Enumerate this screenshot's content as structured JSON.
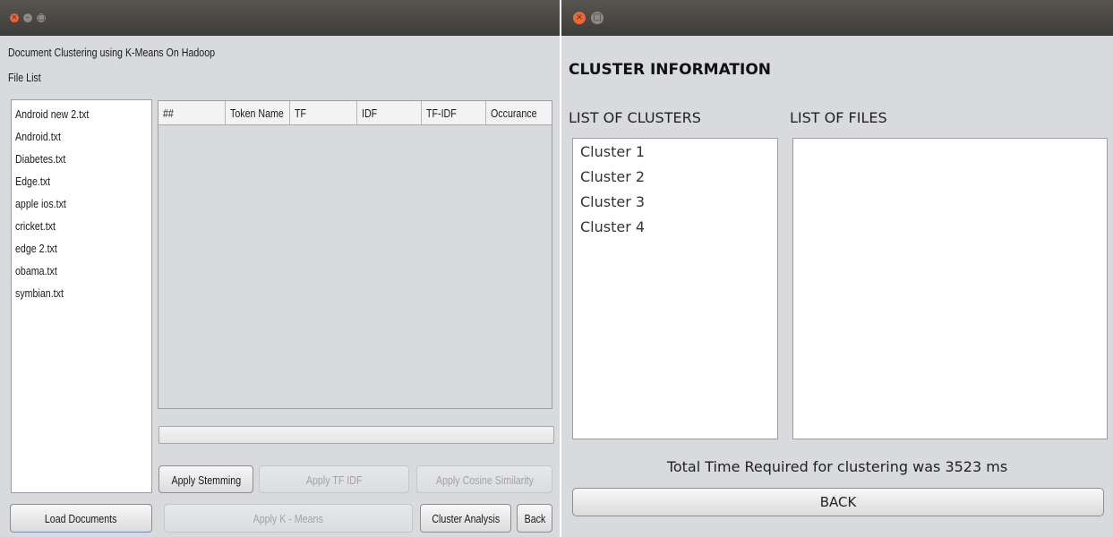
{
  "window1": {
    "heading": "Document Clustering using K-Means On Hadoop",
    "file_list_label": "File List",
    "files": [
      "Android new 2.txt",
      "Android.txt",
      "Diabetes.txt",
      "Edge.txt",
      "apple ios.txt",
      "cricket.txt",
      "edge 2.txt",
      "obama.txt",
      "symbian.txt"
    ],
    "table_headers": [
      "##",
      "Token Name",
      "TF",
      "IDF",
      "TF-IDF",
      "Occurance"
    ],
    "buttons": {
      "apply_stemming": "Apply Stemming",
      "apply_tf_idf": "Apply TF IDF",
      "apply_cosine": "Apply Cosine Similarity",
      "load_documents": "Load  Documents",
      "apply_kmeans": "Apply K - Means",
      "cluster_analysis": "Cluster Analysis",
      "back": "Back"
    }
  },
  "window2": {
    "title": "CLUSTER INFORMATION",
    "list_clusters_label": "LIST OF CLUSTERS",
    "list_files_label": "LIST OF FILES",
    "clusters": [
      "Cluster 1",
      "Cluster 2",
      "Cluster 3",
      "Cluster 4"
    ],
    "total_time": "Total Time Required for clustering was 3523 ms",
    "back_button": "BACK"
  },
  "colors": {
    "titlebar": "#3d3c39",
    "window_bg": "#d8dadd",
    "close_button": "#e9683a"
  }
}
